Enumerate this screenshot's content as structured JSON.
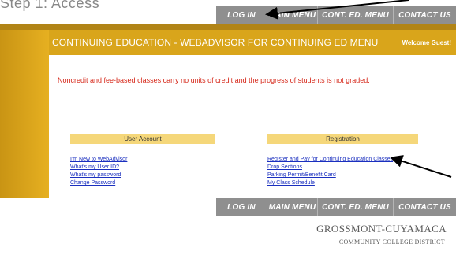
{
  "slide_heading": "Step 1: Access",
  "nav": {
    "login": "LOG IN",
    "main_menu": "MAIN MENU",
    "conted_menu": "CONT. ED. MENU",
    "contact_us": "CONTACT US"
  },
  "header": {
    "title": "CONTINUING EDUCATION - WEBADVISOR FOR CONTINUING ED MENU",
    "welcome": "Welcome Guest!"
  },
  "notice": "Noncredit and fee-based classes carry no units of credit and the progress of students is not graded.",
  "user_account": {
    "title": "User Account",
    "links": [
      "I'm New to WebAdvisor",
      "What's my User ID?",
      "What's my password",
      "Change Password"
    ]
  },
  "registration": {
    "title": "Registration",
    "links": [
      "Register and Pay for Continuing Education Classes",
      "Drop Sections",
      "Parking Permit/Benefit Card",
      "My Class Schedule"
    ]
  },
  "logo": {
    "line1": "GROSSMONT-CUYAMACA",
    "line2": "COMMUNITY COLLEGE DISTRICT"
  },
  "colors": {
    "gold": "#e0ab1c",
    "nav_gray": "#8f8f8f",
    "notice_red": "#d6281a",
    "link_blue": "#1a2fbf",
    "panel_header": "#f5d77a"
  }
}
